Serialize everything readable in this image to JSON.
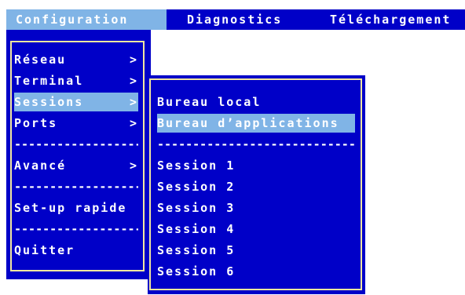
{
  "menubar": {
    "items": [
      {
        "label": "Configuration"
      },
      {
        "label": "Diagnostics"
      },
      {
        "label": "Téléchargement"
      }
    ]
  },
  "config_menu": {
    "items": [
      {
        "label": "Réseau",
        "arrow": ">"
      },
      {
        "label": "Terminal",
        "arrow": ">"
      },
      {
        "label": "Sessions",
        "arrow": ">"
      },
      {
        "label": "Ports",
        "arrow": ">"
      },
      {
        "label": "Avancé",
        "arrow": ">"
      },
      {
        "label": "Set-up rapide"
      },
      {
        "label": "Quitter"
      }
    ],
    "separator": "-------------------------"
  },
  "sessions_menu": {
    "items": [
      {
        "label": "Bureau local"
      },
      {
        "label": "Bureau d’applications"
      },
      {
        "label": "Session 1"
      },
      {
        "label": "Session 2"
      },
      {
        "label": "Session 3"
      },
      {
        "label": "Session 4"
      },
      {
        "label": "Session 5"
      },
      {
        "label": "Session 6"
      }
    ],
    "separator": "-------------------------------"
  },
  "colors": {
    "background": "#0000c8",
    "highlight": "#80b4e6",
    "frame": "#f2e6a0",
    "text": "#ffffff"
  }
}
